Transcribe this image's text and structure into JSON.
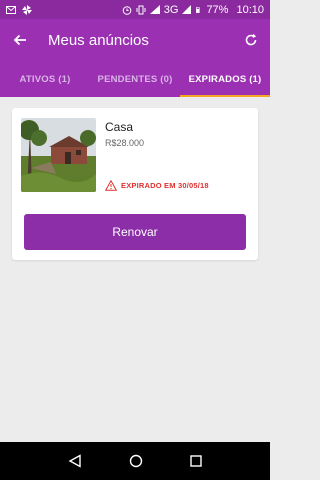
{
  "status_bar": {
    "battery": "77%",
    "time": "10:10",
    "network": "3G"
  },
  "app_bar": {
    "title": "Meus anúncios"
  },
  "tabs": [
    {
      "label": "ATIVOS (1)",
      "active": false
    },
    {
      "label": "PENDENTES (0)",
      "active": false
    },
    {
      "label": "EXPIRADOS (1)",
      "active": true
    }
  ],
  "ad": {
    "title": "Casa",
    "price": "R$28.000",
    "status": "EXPIRADO EM 30/05/18"
  },
  "renew_label": "Renovar",
  "colors": {
    "primary": "#9b30b3",
    "accent": "#f5a623",
    "error": "#e0302f",
    "button": "#8b2ea7"
  }
}
